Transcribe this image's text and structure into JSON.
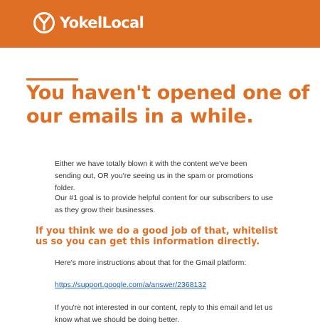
{
  "header": {
    "brand_name": "YokelLocal",
    "logo_icon": "yokel-y-circle-logo",
    "color": "#de6f25"
  },
  "email": {
    "headline": "You haven't opened one of our emails in a while.",
    "para1": "Either we have totally blown it with the content we've been sending out, OR you're seeing us in the spam or promotions folder.",
    "para2": "Our #1 goal is to provide helpful content for our subscribers to use as they grow their businesses.",
    "callout": "If you think we do a good job of that, whitelist us so you can get this information directly.",
    "para3": "Here's more instructions about that for the Gmail platform:",
    "link_text": "https://support.google.com/a/answer/2368132",
    "para4": "If you're not interested in our content, reply to this email and let us know what we should be doing better."
  },
  "colors": {
    "accent": "#de6f25",
    "body_text": "#333333",
    "link": "#1a5fc4"
  }
}
